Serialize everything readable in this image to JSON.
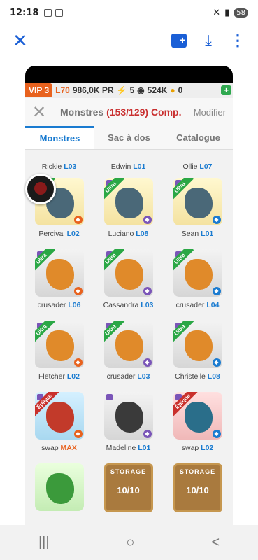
{
  "status": {
    "time": "12:18",
    "battery": "58"
  },
  "appbar": {
    "close_icon": "close-icon",
    "more_icon": "more-icon"
  },
  "hud": {
    "vip": "VIP 3",
    "level": "L70",
    "power": "986,0K PR",
    "energy": "5",
    "silver": "524K",
    "gold": "0",
    "plus": "+"
  },
  "header": {
    "title": "Monstres",
    "count": "(153/129) Comp.",
    "modify": "Modifier"
  },
  "tabs": [
    "Monstres",
    "Sac à dos",
    "Catalogue"
  ],
  "partial_names": [
    {
      "name": "Rickie",
      "level": "L03"
    },
    {
      "name": "Edwin",
      "level": "L01"
    },
    {
      "name": "Ollie",
      "level": "L07"
    }
  ],
  "monsters": [
    {
      "name": "Percival",
      "level": "L02",
      "rarity": "Ultra",
      "bg": "yellow"
    },
    {
      "name": "Luciano",
      "level": "L08",
      "rarity": "Ultra",
      "bg": "yellow"
    },
    {
      "name": "Sean",
      "level": "L01",
      "rarity": "Ultra",
      "bg": "yellow"
    },
    {
      "name": "crusader",
      "level": "L06",
      "rarity": "Ultra",
      "bg": "grey"
    },
    {
      "name": "Cassandra",
      "level": "L03",
      "rarity": "Ultra",
      "bg": "grey"
    },
    {
      "name": "crusader",
      "level": "L04",
      "rarity": "Ultra",
      "bg": "grey"
    },
    {
      "name": "Fletcher",
      "level": "L02",
      "rarity": "Ultra",
      "bg": "grey"
    },
    {
      "name": "crusader",
      "level": "L03",
      "rarity": "Ultra",
      "bg": "grey"
    },
    {
      "name": "Christelle",
      "level": "L08",
      "rarity": "Ultra",
      "bg": "grey"
    },
    {
      "name": "swap",
      "level": "MAX",
      "rarity": "Épique",
      "bg": "blue"
    },
    {
      "name": "Madeline",
      "level": "L01",
      "rarity": "",
      "bg": "grey"
    },
    {
      "name": "swap",
      "level": "L02",
      "rarity": "Épique",
      "bg": "red"
    }
  ],
  "bottom": {
    "storage_label": "STORAGE",
    "storage_1": "10/10",
    "storage_2": "10/10"
  },
  "nav": [
    "|||",
    "○",
    "<"
  ]
}
